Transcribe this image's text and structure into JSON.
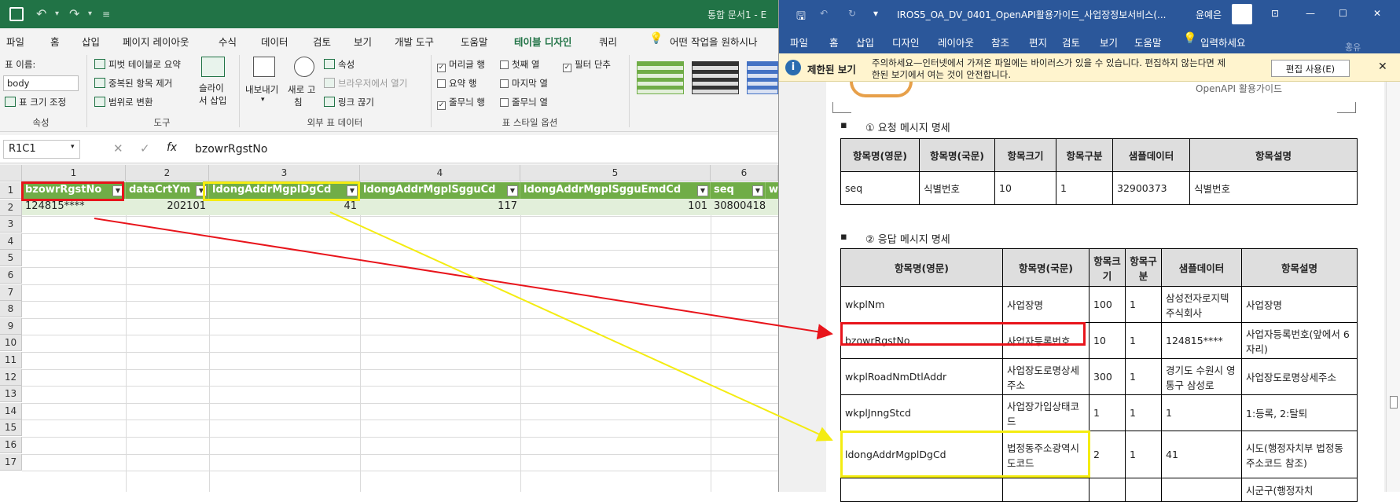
{
  "excel": {
    "doc_title": "통합 문서1 - E",
    "menu": [
      "파일",
      "홈",
      "삽입",
      "페이지 레이아웃",
      "수식",
      "데이터",
      "검토",
      "보기",
      "개발 도구",
      "도움말",
      "테이블 디자인",
      "쿼리"
    ],
    "tell_me": "어떤 작업을 원하시나",
    "ribbon": {
      "table_name_label": "표 이름:",
      "table_name_value": "body",
      "resize_table": "표 크기 조정",
      "group_props": "속성",
      "pivot_summary": "피벗 테이블로 요약",
      "remove_duplicates": "중복된 항목 제거",
      "convert_to_range": "범위로 변환",
      "slicer_line1": "슬라이",
      "slicer_line2": "서 삽입",
      "group_tools": "도구",
      "export_line1": "내보내기",
      "refresh_line1": "새로 고",
      "refresh_line2": "침",
      "properties": "속성",
      "open_in_browser": "브라우저에서 열기",
      "unlink": "링크 끊기",
      "group_external": "외부 표 데이터",
      "header_row": "머리글 행",
      "total_row": "요약 행",
      "banded_rows": "줄무늬 행",
      "first_column": "첫째 열",
      "last_column": "마지막 열",
      "banded_columns": "줄무늬 열",
      "filter_button": "필터 단추",
      "group_style_options": "표 스타일 옵션"
    },
    "namebox": "R1C1",
    "formula": "bzowrRgstNo",
    "columns": [
      "1",
      "2",
      "3",
      "4",
      "5",
      "6"
    ],
    "rows": [
      "1",
      "2",
      "3",
      "4",
      "5",
      "6",
      "7",
      "8",
      "9",
      "10",
      "11",
      "12",
      "13",
      "14",
      "15",
      "16",
      "17"
    ],
    "headers": [
      "bzowrRgstNo",
      "dataCrtYm",
      "ldongAddrMgplDgCd",
      "ldongAddrMgplSgguCd",
      "ldongAddrMgplSgguEmdCd",
      "seq",
      "w"
    ],
    "row2": [
      "124815****",
      "202101",
      "41",
      "117",
      "101",
      "30800418"
    ]
  },
  "word": {
    "title": "IROS5_OA_DV_0401_OpenAPI활용가이드_사업장정보서비스(...",
    "user": "윤예은",
    "menu": [
      "파일",
      "홈",
      "삽입",
      "디자인",
      "레이아웃",
      "참조",
      "편지",
      "검토",
      "보기",
      "도움말"
    ],
    "tell_me": "입력하세요",
    "share": "공유",
    "warn_title": "제한된 보기",
    "warn_text_line1": "주의하세요—인터넷에서 가져온 파일에는 바이러스가 있을 수 있습니다. 편집하지 않는다면 제",
    "warn_text_line2": "한된 보기에서 여는 것이 안전합니다.",
    "enable_edit": "편집 사용(E)",
    "page_header": "OpenAPI 활용가이드",
    "req_title": "① 요청 메시지 명세",
    "req_headers": [
      "항목명(영문)",
      "항목명(국문)",
      "항목크기",
      "항목구분",
      "샘플데이터",
      "항목설명"
    ],
    "req_rows": [
      [
        "seq",
        "식별번호",
        "10",
        "1",
        "32900373",
        "식별번호"
      ]
    ],
    "resp_title": "② 응답 메시지 명세",
    "resp_headers": [
      "항목명(영문)",
      "항목명(국문)",
      "항목크기",
      "항목구분",
      "샘플데이터",
      "항목설명"
    ],
    "resp_rows": [
      [
        "wkplNm",
        "사업장명",
        "100",
        "1",
        "삼성전자로지텍주식회사",
        "사업장명"
      ],
      [
        "bzowrRgstNo",
        "사업자등록번호",
        "10",
        "1",
        "124815****",
        "사업자등록번호(앞에서 6자리)"
      ],
      [
        "wkplRoadNmDtlAddr",
        "사업장도로명상세주소",
        "300",
        "1",
        "경기도 수원시 영통구 삼성로",
        "사업장도로명상세주소"
      ],
      [
        "wkplJnngStcd",
        "사업장가입상태코드",
        "1",
        "1",
        "1",
        "1:등록, 2:탈퇴"
      ],
      [
        "ldongAddrMgplDgCd",
        "법정동주소광역시도코드",
        "2",
        "1",
        "41",
        "시도(행정자치부 법정동 주소코드 참조)"
      ],
      [
        "",
        "",
        "",
        "",
        "",
        "시군구(행정자치"
      ]
    ]
  },
  "colors": {
    "excel_green": "#217346",
    "table_header": "#70ad47",
    "word_blue": "#2b579a",
    "red_highlight": "#e8141b",
    "yellow_highlight": "#f4ec11"
  }
}
